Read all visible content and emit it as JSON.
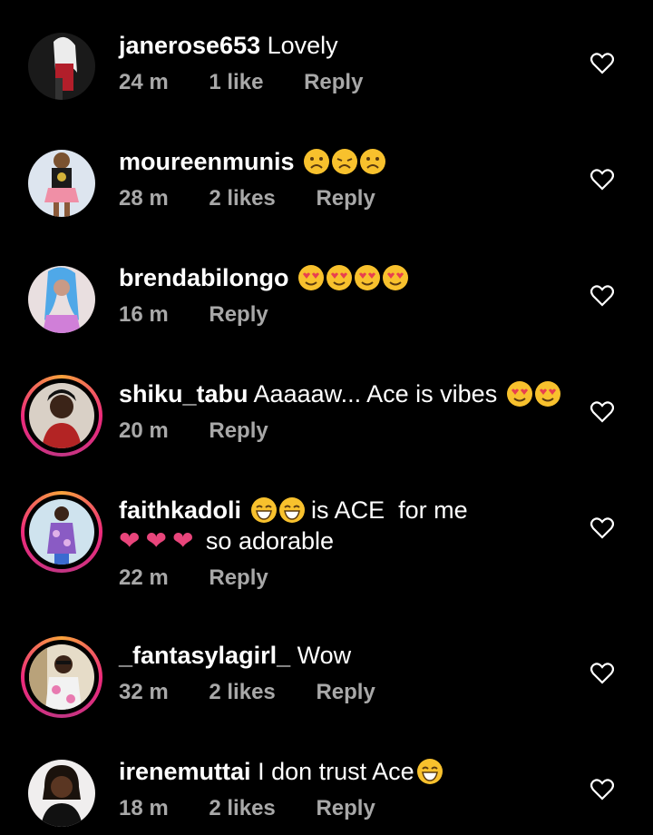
{
  "comments": [
    {
      "username": "janerose653",
      "text": "Lovely",
      "emojis": [],
      "time": "24 m",
      "likes": "1 like",
      "reply": "Reply"
    },
    {
      "username": "moureenmunis",
      "text": "",
      "emojis": [
        "frowning-face",
        "tired-face",
        "frowning-face"
      ],
      "time": "28 m",
      "likes": "2 likes",
      "reply": "Reply"
    },
    {
      "username": "brendabilongo",
      "text": "",
      "emojis": [
        "heart-eyes-face",
        "heart-eyes-face",
        "heart-eyes-face",
        "heart-eyes-face"
      ],
      "time": "16 m",
      "likes": "",
      "reply": "Reply"
    },
    {
      "username": "shiku_tabu",
      "text": "Aaaaaw... Ace is vibes",
      "emojis": [
        "heart-eyes-face",
        "heart-eyes-face"
      ],
      "time": "20 m",
      "likes": "",
      "reply": "Reply"
    },
    {
      "username": "faithkadoli",
      "text": "is ACE  for me",
      "emojis": [
        "grinning-face",
        "grinning-face"
      ],
      "line2_text": "so adorable",
      "line2_emojis": [
        "pink-heart",
        "pink-heart",
        "pink-heart"
      ],
      "time": "22 m",
      "likes": "",
      "reply": "Reply"
    },
    {
      "username": "_fantasylagirl_",
      "text": "Wow",
      "emojis": [],
      "time": "32 m",
      "likes": "2 likes",
      "reply": "Reply"
    },
    {
      "username": "irenemuttai",
      "text": "I don trust Ace",
      "emojis": [
        "grinning-face"
      ],
      "time": "18 m",
      "likes": "2 likes",
      "reply": "Reply"
    }
  ],
  "colors": {
    "background": "#000000",
    "text": "#ffffff",
    "meta": "#a8a8a8",
    "emoji": "#f8c12d",
    "heart_pink": "#e8457b"
  }
}
